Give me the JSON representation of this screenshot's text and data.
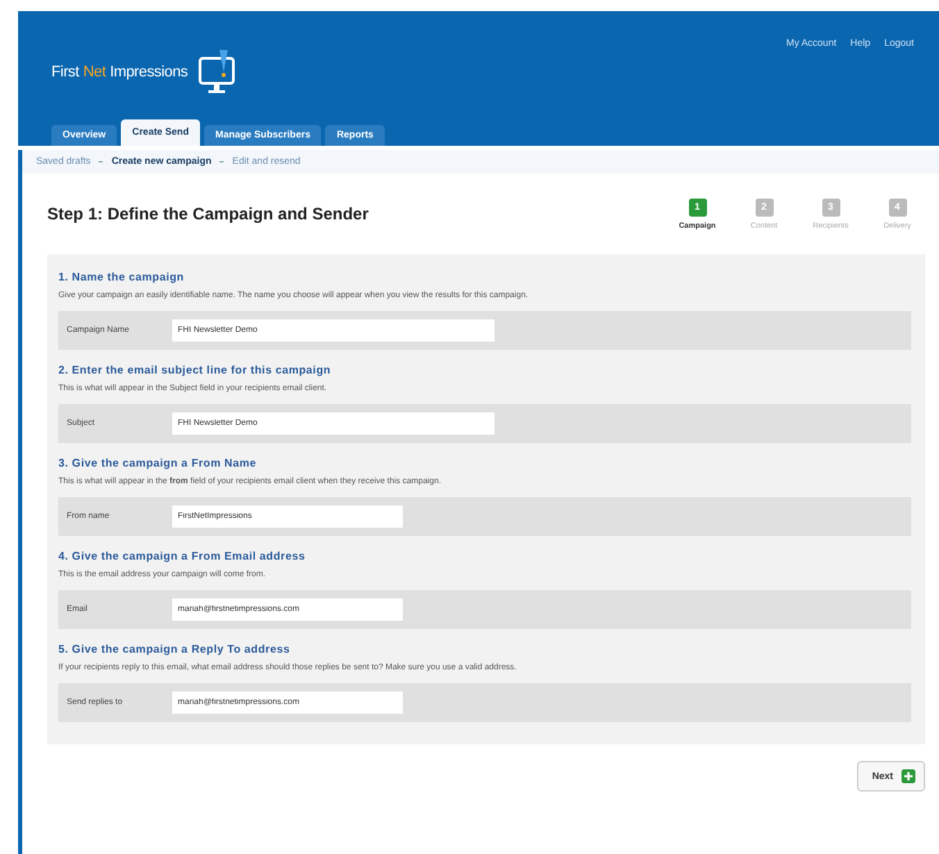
{
  "header": {
    "logo": {
      "parts": [
        {
          "text": "First",
          "accent": false
        },
        {
          "text": "Net",
          "accent": true
        },
        {
          "text": "Impressions",
          "accent": false
        }
      ]
    },
    "links": [
      "My Account",
      "Help",
      "Logout"
    ]
  },
  "tabs": [
    {
      "label": "Overview",
      "selected": false
    },
    {
      "label": "Create Send",
      "selected": true
    },
    {
      "label": "Manage Subscribers",
      "selected": false
    },
    {
      "label": "Reports",
      "selected": false
    }
  ],
  "breadcrumb": [
    {
      "label": "Saved drafts",
      "current": false
    },
    {
      "label": "Create new campaign",
      "current": true
    },
    {
      "label": "Edit and resend",
      "current": false
    }
  ],
  "page_title": "Step 1: Define the Campaign and Sender",
  "steps": [
    {
      "number": "1",
      "label": "Campaign",
      "selected": true
    },
    {
      "number": "2",
      "label": "Content",
      "selected": false
    },
    {
      "number": "3",
      "label": "Recipients",
      "selected": false
    },
    {
      "number": "4",
      "label": "Delivery",
      "selected": false
    }
  ],
  "sections": [
    {
      "title": "1. Name the campaign",
      "description": "Give your campaign an easily identifiable name. The name you choose will appear when you view the results for this campaign.",
      "field_label": "Campaign Name",
      "value": "FHI Newsletter Demo",
      "wide": true
    },
    {
      "title": "2. Enter the email subject line for this campaign",
      "description": "This is what will appear in the Subject field in your recipients email client.",
      "field_label": "Subject",
      "value": "FHI Newsletter Demo",
      "wide": true
    },
    {
      "title": "3. Give the campaign a From Name",
      "description": "This is what will appear in the **from** field of your recipients email client when they receive this campaign.",
      "field_label": "From name",
      "value": "FirstNetImpressions",
      "wide": false
    },
    {
      "title": "4. Give the campaign a From Email address",
      "description": "This is the email address your campaign will come from.",
      "field_label": "Email",
      "value": "mariah@firstnetimpressions.com",
      "wide": false
    },
    {
      "title": "5. Give the campaign a Reply To address",
      "description": "If your recipients reply to this email, what email address should those replies be sent to? Make sure you use a valid address.",
      "field_label": "Send replies to",
      "value": "mariah@firstnetimpressions.com",
      "wide": false
    }
  ],
  "next_button": "Next"
}
